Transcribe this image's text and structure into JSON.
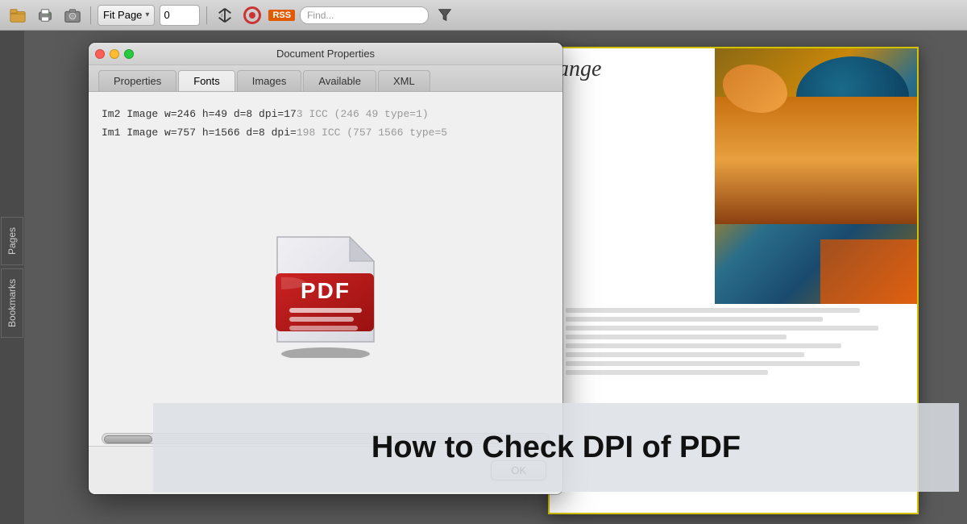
{
  "toolbar": {
    "fit_page_label": "Fit Page",
    "page_number": "0",
    "cursor_icon": "↕",
    "rss_label": "RSS",
    "search_placeholder": "Find...",
    "icons": {
      "open": "open-folder-icon",
      "print": "print-icon",
      "camera": "camera-icon",
      "cursor": "cursor-icon",
      "lifesaver": "lifesaver-icon",
      "funnel": "funnel-icon"
    }
  },
  "sidebar": {
    "tabs": [
      {
        "id": "pages",
        "label": "Pages"
      },
      {
        "id": "bookmarks",
        "label": "Bookmarks"
      }
    ]
  },
  "dialog": {
    "title": "Document Properties",
    "tabs": [
      {
        "id": "properties",
        "label": "Properties",
        "active": false
      },
      {
        "id": "fonts",
        "label": "Fonts",
        "active": false
      },
      {
        "id": "images",
        "label": "Images",
        "active": true
      },
      {
        "id": "available",
        "label": "Available",
        "active": false
      },
      {
        "id": "xml",
        "label": "XML",
        "active": false
      }
    ],
    "images_content": {
      "line1_prefix": "Im2 Image w=246 h=49 d=8 dpi=17",
      "line1_faded": "3 ICC (246 49 type=1)",
      "line2_prefix": "Im1 Image w=757 h=1566 d=8 dpi=",
      "line2_faded": "198 ICC (757 1566 type=5"
    },
    "ok_button": "OK",
    "window_controls": {
      "close": "×",
      "minimize": "−",
      "maximize": "+"
    }
  },
  "pdf_page": {
    "title_text": "ange"
  },
  "banner": {
    "text": "How to Check DPI of PDF"
  }
}
